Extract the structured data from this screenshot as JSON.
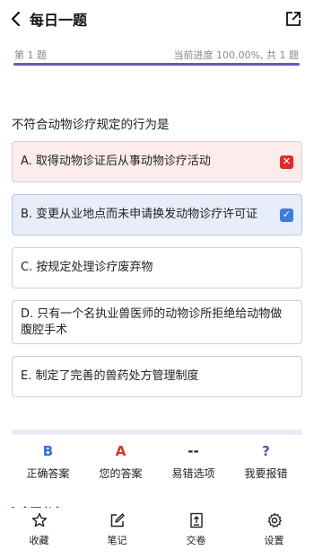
{
  "header": {
    "title": "每日一题"
  },
  "progress": {
    "question_label": "第 1 题",
    "status_text": "当前进度 100.00%, 共 1 题",
    "fraction": 1.0,
    "accent_color": "#6a55c8"
  },
  "question": {
    "text": "不符合动物诊疗规定的行为是"
  },
  "options": [
    {
      "label": "A. 取得动物诊证后从事动物诊疗活动",
      "state": "wrong"
    },
    {
      "label": "B. 变更从业地点而未申请换发动物诊疗许可证",
      "state": "correct"
    },
    {
      "label": "C. 按规定处理诊疗废弃物",
      "state": "none"
    },
    {
      "label": "D. 只有一个名执业兽医师的动物诊所拒绝给动物做腹腔手术",
      "state": "none"
    },
    {
      "label": "E. 制定了完善的兽药处方管理制度",
      "state": "none"
    }
  ],
  "stats": {
    "correct_answer": {
      "value": "B",
      "label": "正确答案",
      "color": "#2f72d6"
    },
    "your_answer": {
      "value": "A",
      "label": "您的答案",
      "color": "#d9302c"
    },
    "common_mistake": {
      "value": "--",
      "label": "易错选项",
      "color": "#222222"
    },
    "report": {
      "value": "?",
      "label": "我要报错",
      "color": "#5b4bbf"
    }
  },
  "section": {
    "title": "来源考点"
  },
  "nav": {
    "favorite": "收藏",
    "notes": "笔记",
    "submit": "交卷",
    "settings": "设置"
  },
  "icons": [
    "back-icon",
    "share-icon",
    "wrong-mark-icon",
    "check-mark-icon",
    "star-icon",
    "edit-icon",
    "submit-paper-icon",
    "gear-icon"
  ]
}
